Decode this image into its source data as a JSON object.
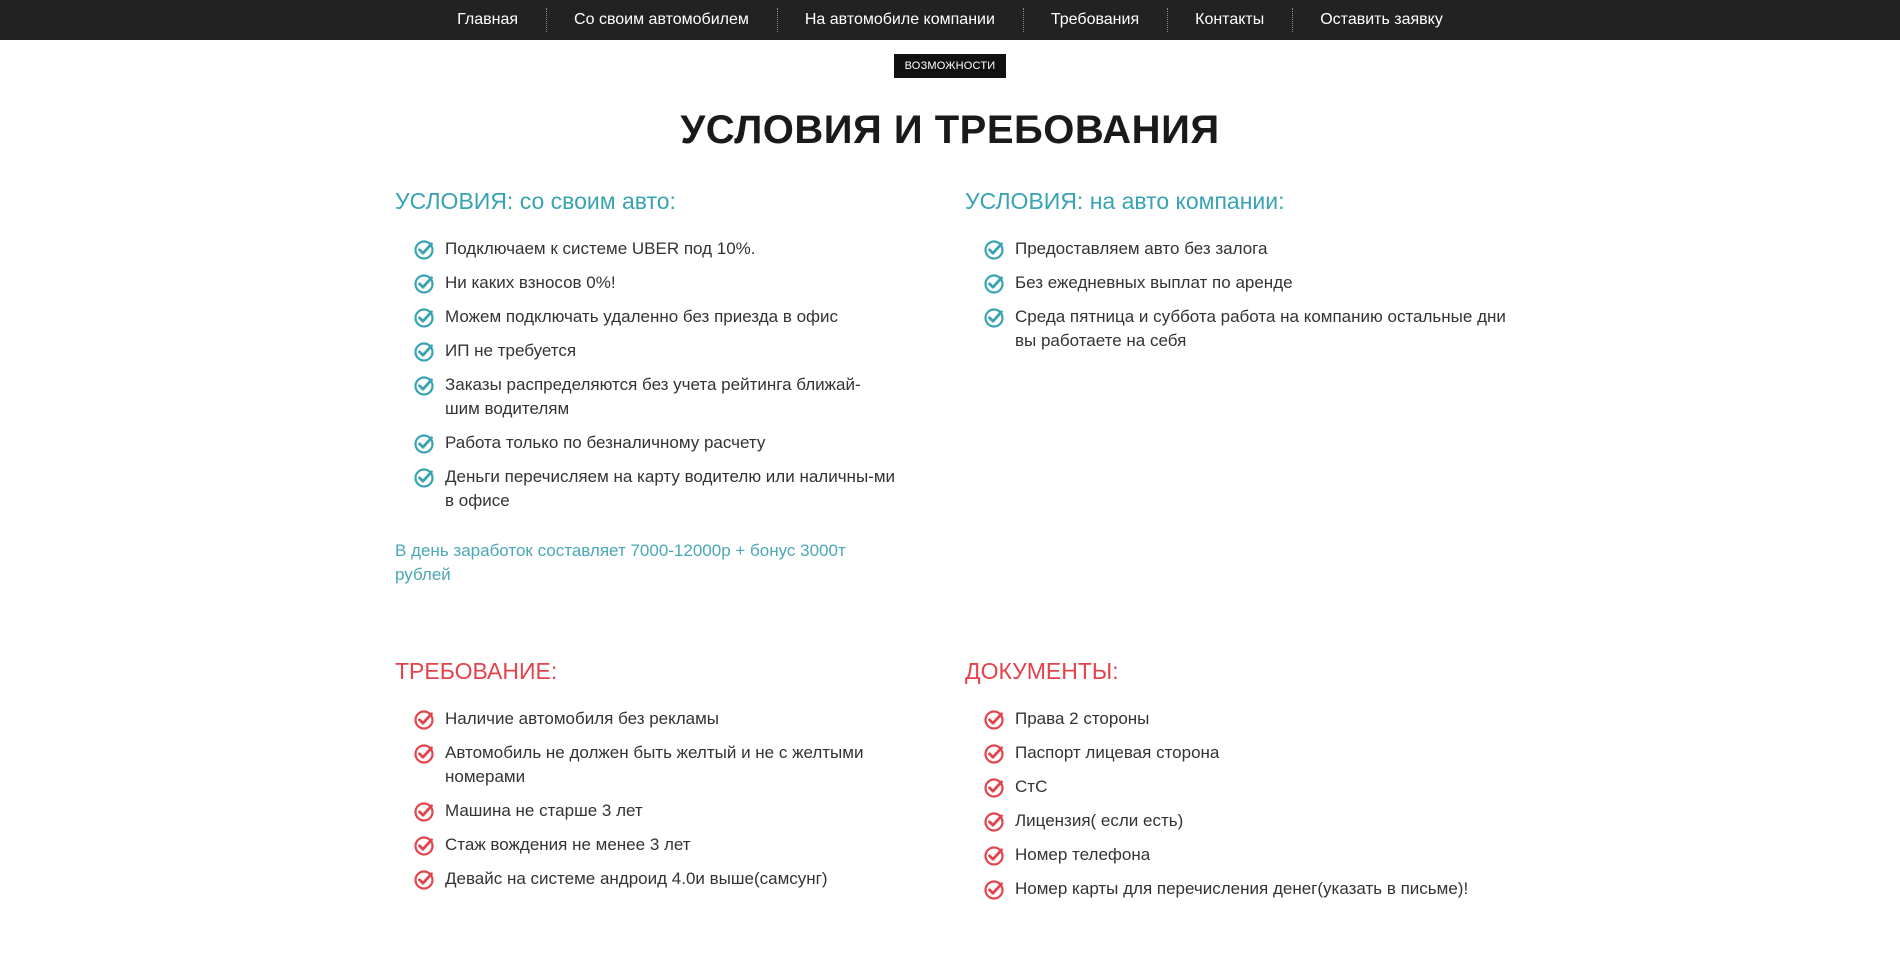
{
  "nav": {
    "items": [
      "Главная",
      "Со своим автомобилем",
      "На автомобиле компании",
      "Требования",
      "Контакты",
      "Оставить заявку"
    ]
  },
  "badge": "возможности",
  "title": "УСЛОВИЯ И ТРЕБОВАНИЯ",
  "colors": {
    "teal": "#37a3b3",
    "red": "#e3434b",
    "nav_bg": "#222222"
  },
  "own_car": {
    "title": "УСЛОВИЯ: со своим авто:",
    "items": [
      "Подключаем к системе UBER под 10%.",
      "Ни каких взносов 0%!",
      "Можем подключать удаленно без приезда в офис",
      "ИП не требуется",
      "Заказы распределяются без учета рейтинга ближай-шим водителям",
      "Работа только по безналичному расчету",
      "Деньги перечисляем на карту водителю или наличны-ми в офисе"
    ],
    "note": "В день заработок составляет 7000-12000р + бонус 3000т рублей"
  },
  "company_car": {
    "title": "УСЛОВИЯ: на авто компании:",
    "items": [
      "Предоставляем авто без залога",
      "Без ежедневных выплат по аренде",
      "Среда пятница и суббота работа на компанию остальные дни вы работаете на себя"
    ]
  },
  "requirements": {
    "title": "ТРЕБОВАНИЕ:",
    "items": [
      "Наличие автомобиля без рекламы",
      "Автомобиль не должен быть желтый и не с желтыми номерами",
      "Машина не старше 3 лет",
      "Стаж вождения не менее 3 лет",
      "Девайс на системе андроид 4.0и выше(самсунг)"
    ]
  },
  "documents": {
    "title": "ДОКУМЕНТЫ:",
    "items": [
      "Права 2 стороны",
      "Паспорт лицевая сторона",
      "СтС",
      "Лицензия( если есть)",
      "Номер телефона",
      "Номер карты для перечисления денег(указать в письме)!"
    ]
  }
}
